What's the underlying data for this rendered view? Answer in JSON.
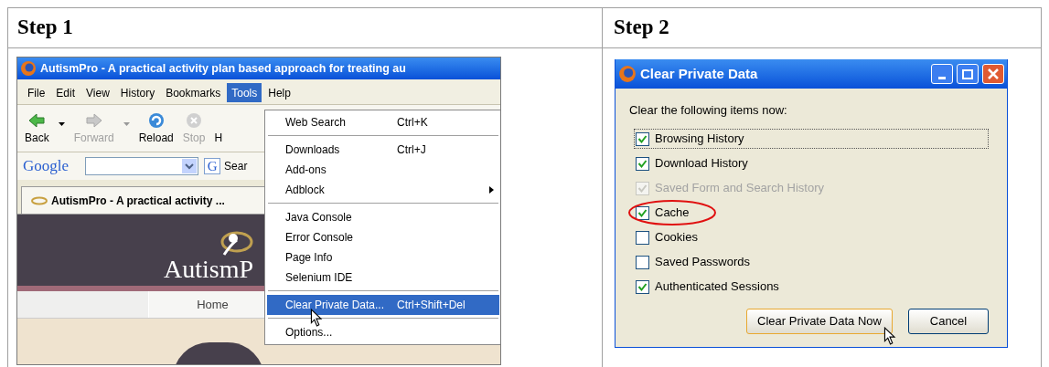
{
  "table": {
    "headers": [
      "Step 1",
      "Step 2"
    ]
  },
  "step1": {
    "window_title": "AutismPro - A practical activity plan based approach for treating au",
    "menu": [
      {
        "label": "File",
        "selected": false
      },
      {
        "label": "Edit",
        "selected": false
      },
      {
        "label": "View",
        "selected": false
      },
      {
        "label": "History",
        "selected": false
      },
      {
        "label": "Bookmarks",
        "selected": false
      },
      {
        "label": "Tools",
        "selected": true
      },
      {
        "label": "Help",
        "selected": false
      }
    ],
    "toolbar": [
      {
        "kind": "back",
        "label": "Back",
        "disabled": false
      },
      {
        "kind": "forward",
        "label": "Forward",
        "disabled": true
      },
      {
        "kind": "reload",
        "label": "Reload",
        "disabled": false
      },
      {
        "kind": "stop",
        "label": "Stop",
        "disabled": true
      },
      {
        "kind": "cut",
        "label": "H",
        "disabled": false
      }
    ],
    "search_bar": {
      "logo": "Google",
      "button_glyph": "G",
      "button_label": "Sear"
    },
    "tab": {
      "title": "AutismPro - A practical activity ..."
    },
    "site": {
      "logo": "AutismP",
      "nav": [
        "Home"
      ]
    },
    "tools_menu": [
      {
        "kind": "item",
        "label": "Web Search",
        "shortcut": "Ctrl+K",
        "selected": false,
        "submenu": false
      },
      {
        "kind": "separator"
      },
      {
        "kind": "item",
        "label": "Downloads",
        "shortcut": "Ctrl+J",
        "selected": false,
        "submenu": false
      },
      {
        "kind": "item",
        "label": "Add-ons",
        "selected": false,
        "submenu": false
      },
      {
        "kind": "item",
        "label": "Adblock",
        "selected": false,
        "submenu": true
      },
      {
        "kind": "separator"
      },
      {
        "kind": "item",
        "label": "Java Console",
        "selected": false,
        "submenu": false
      },
      {
        "kind": "item",
        "label": "Error Console",
        "selected": false,
        "submenu": false
      },
      {
        "kind": "item",
        "label": "Page Info",
        "selected": false,
        "submenu": false
      },
      {
        "kind": "item",
        "label": "Selenium IDE",
        "selected": false,
        "submenu": false
      },
      {
        "kind": "separator"
      },
      {
        "kind": "item",
        "label": "Clear Private Data...",
        "shortcut": "Ctrl+Shift+Del",
        "selected": true,
        "submenu": false
      },
      {
        "kind": "separator"
      },
      {
        "kind": "item",
        "label": "Options...",
        "selected": false,
        "submenu": false
      }
    ]
  },
  "step2": {
    "dialog_title": "Clear Private Data",
    "prompt": "Clear the following items now:",
    "items": [
      {
        "label": "Browsing History",
        "checked": true,
        "disabled": false,
        "focused": true,
        "circled": false
      },
      {
        "label": "Download History",
        "checked": true,
        "disabled": false,
        "focused": false,
        "circled": false
      },
      {
        "label": "Saved Form and Search History",
        "checked": true,
        "disabled": true,
        "focused": false,
        "circled": false
      },
      {
        "label": "Cache",
        "checked": true,
        "disabled": false,
        "focused": false,
        "circled": true
      },
      {
        "label": "Cookies",
        "checked": false,
        "disabled": false,
        "focused": false,
        "circled": false
      },
      {
        "label": "Saved Passwords",
        "checked": false,
        "disabled": false,
        "focused": false,
        "circled": false
      },
      {
        "label": "Authenticated Sessions",
        "checked": true,
        "disabled": false,
        "focused": false,
        "circled": false
      }
    ],
    "buttons": [
      {
        "label": "Clear Private Data Now",
        "default": true
      },
      {
        "label": "Cancel",
        "default": false
      }
    ]
  }
}
